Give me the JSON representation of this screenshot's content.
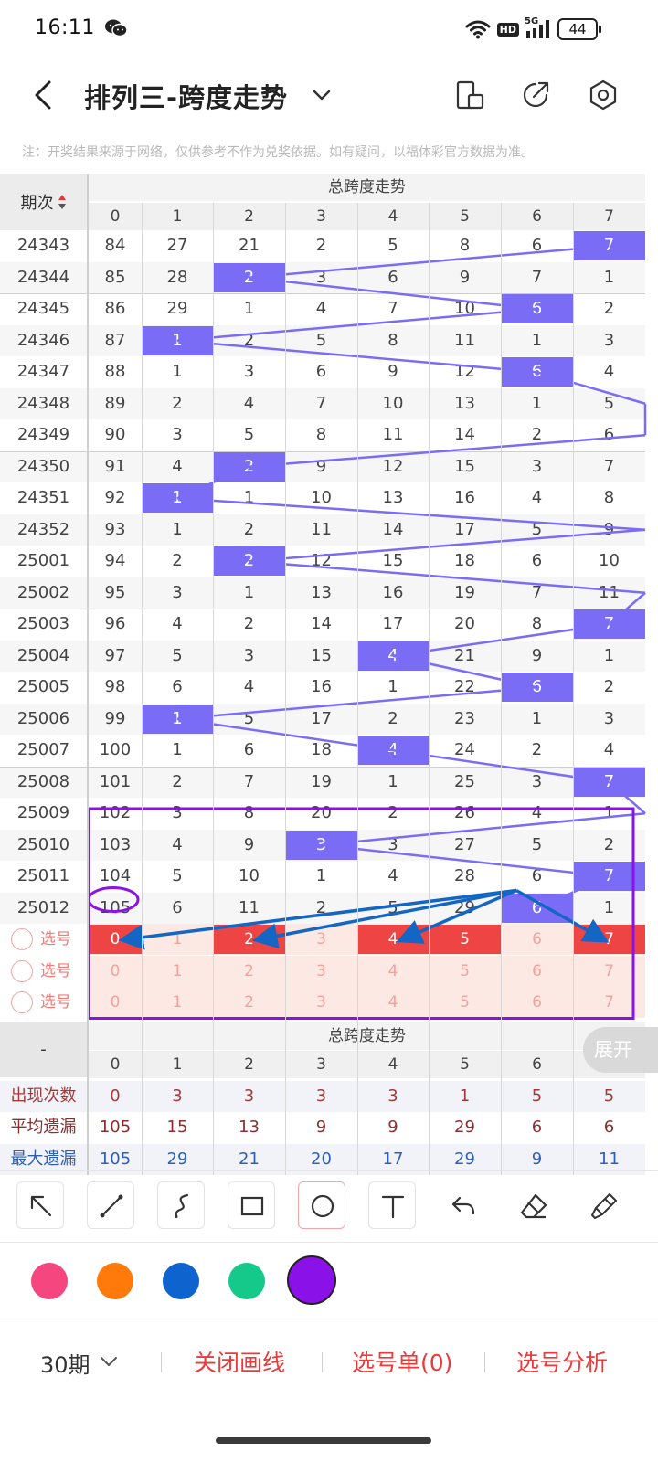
{
  "status_bar": {
    "time": "16:11",
    "hd": "HD",
    "net": "5G",
    "battery": "44"
  },
  "title_bar": {
    "title": "排列三-跨度走势"
  },
  "notice": "注：开奖结果来源于网络，仅供参考不作为兑奖依据。如有疑问，以福体彩官方数据为准。",
  "table": {
    "period_header": "期次",
    "trend_header": "总跨度走势",
    "columns": [
      "0",
      "1",
      "2",
      "3",
      "4",
      "5",
      "6",
      "7"
    ],
    "rows": [
      {
        "period": "24343",
        "cells": [
          "84",
          "27",
          "21",
          "2",
          "5",
          "8",
          "6",
          "7"
        ],
        "hit": 7
      },
      {
        "period": "24344",
        "cells": [
          "85",
          "28",
          "2",
          "3",
          "6",
          "9",
          "7",
          "1"
        ],
        "hit": 2
      },
      {
        "period": "24345",
        "cells": [
          "86",
          "29",
          "1",
          "4",
          "7",
          "10",
          "6",
          "2"
        ],
        "hit": 6
      },
      {
        "period": "24346",
        "cells": [
          "87",
          "1",
          "2",
          "5",
          "8",
          "11",
          "1",
          "3"
        ],
        "hit": 1
      },
      {
        "period": "24347",
        "cells": [
          "88",
          "1",
          "3",
          "6",
          "9",
          "12",
          "6",
          "4"
        ],
        "hit": 6
      },
      {
        "period": "24348",
        "cells": [
          "89",
          "2",
          "4",
          "7",
          "10",
          "13",
          "1",
          "5"
        ],
        "hit": -1
      },
      {
        "period": "24349",
        "cells": [
          "90",
          "3",
          "5",
          "8",
          "11",
          "14",
          "2",
          "6"
        ],
        "hit": -1
      },
      {
        "period": "24350",
        "cells": [
          "91",
          "4",
          "2",
          "9",
          "12",
          "15",
          "3",
          "7"
        ],
        "hit": 2
      },
      {
        "period": "24351",
        "cells": [
          "92",
          "1",
          "1",
          "10",
          "13",
          "16",
          "4",
          "8"
        ],
        "hit": 1
      },
      {
        "period": "24352",
        "cells": [
          "93",
          "1",
          "2",
          "11",
          "14",
          "17",
          "5",
          "9"
        ],
        "hit": -1
      },
      {
        "period": "25001",
        "cells": [
          "94",
          "2",
          "2",
          "12",
          "15",
          "18",
          "6",
          "10"
        ],
        "hit": 2
      },
      {
        "period": "25002",
        "cells": [
          "95",
          "3",
          "1",
          "13",
          "16",
          "19",
          "7",
          "11"
        ],
        "hit": -1
      },
      {
        "period": "25003",
        "cells": [
          "96",
          "4",
          "2",
          "14",
          "17",
          "20",
          "8",
          "7"
        ],
        "hit": 7
      },
      {
        "period": "25004",
        "cells": [
          "97",
          "5",
          "3",
          "15",
          "4",
          "21",
          "9",
          "1"
        ],
        "hit": 4
      },
      {
        "period": "25005",
        "cells": [
          "98",
          "6",
          "4",
          "16",
          "1",
          "22",
          "6",
          "2"
        ],
        "hit": 6
      },
      {
        "period": "25006",
        "cells": [
          "99",
          "1",
          "5",
          "17",
          "2",
          "23",
          "1",
          "3"
        ],
        "hit": 1
      },
      {
        "period": "25007",
        "cells": [
          "100",
          "1",
          "6",
          "18",
          "4",
          "24",
          "2",
          "4"
        ],
        "hit": 4
      },
      {
        "period": "25008",
        "cells": [
          "101",
          "2",
          "7",
          "19",
          "1",
          "25",
          "3",
          "7"
        ],
        "hit": 7
      },
      {
        "period": "25009",
        "cells": [
          "102",
          "3",
          "8",
          "20",
          "2",
          "26",
          "4",
          "1"
        ],
        "hit": -1
      },
      {
        "period": "25010",
        "cells": [
          "103",
          "4",
          "9",
          "3",
          "3",
          "27",
          "5",
          "2"
        ],
        "hit": 3
      },
      {
        "period": "25011",
        "cells": [
          "104",
          "5",
          "10",
          "1",
          "4",
          "28",
          "6",
          "7"
        ],
        "hit": 7
      },
      {
        "period": "25012",
        "cells": [
          "105",
          "6",
          "11",
          "2",
          "5",
          "29",
          "6",
          "1"
        ],
        "hit": 6
      }
    ],
    "pick_rows": [
      {
        "label": "选号",
        "cells": [
          "0",
          "1",
          "2",
          "3",
          "4",
          "5",
          "6",
          "7"
        ],
        "selected": [
          0,
          2,
          4,
          5,
          7
        ]
      },
      {
        "label": "选号",
        "cells": [
          "0",
          "1",
          "2",
          "3",
          "4",
          "5",
          "6",
          "7"
        ],
        "selected": []
      },
      {
        "label": "选号",
        "cells": [
          "0",
          "1",
          "2",
          "3",
          "4",
          "5",
          "6",
          "7"
        ],
        "selected": []
      }
    ],
    "footer_left": "-",
    "footer_trend_header": "总跨度走势",
    "footer_columns": [
      "0",
      "1",
      "2",
      "3",
      "4",
      "5",
      "6",
      "7"
    ],
    "stats": [
      {
        "label": "出现次数",
        "values": [
          "0",
          "3",
          "3",
          "3",
          "3",
          "1",
          "5",
          "5"
        ],
        "color": "#a33a3a"
      },
      {
        "label": "平均遗漏",
        "values": [
          "105",
          "15",
          "13",
          "9",
          "9",
          "29",
          "6",
          "6"
        ],
        "color": "#8a2f2f"
      },
      {
        "label": "最大遗漏",
        "values": [
          "105",
          "29",
          "21",
          "20",
          "17",
          "29",
          "9",
          "11"
        ],
        "color": "#2f5fb5"
      }
    ],
    "expand_label": "展开"
  },
  "drawing_tools": [
    "arrow-tool",
    "line-tool",
    "curve-tool",
    "rectangle-tool",
    "circle-tool",
    "text-tool",
    "undo-tool",
    "eraser-tool",
    "clear-tool"
  ],
  "active_tool": "circle-tool",
  "colors": [
    "#f5467f",
    "#ff7a0a",
    "#0f63cf",
    "#14c98a",
    "#8a12e8"
  ],
  "active_color": "#8a12e8",
  "bottom_bar": {
    "period_select": "30期",
    "close_draw": "关闭画线",
    "pick_list": "选号单(0)",
    "pick_analysis": "选号分析"
  },
  "accent_colors": {
    "hit": "#7b6cf6",
    "selected": "#ef4444",
    "action": "#ea3a3a"
  }
}
